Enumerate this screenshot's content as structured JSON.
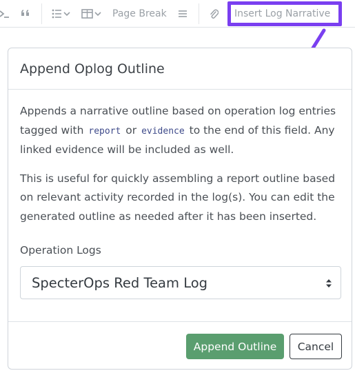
{
  "toolbar": {
    "page_break_label": "Page Break",
    "insert_log_label": "Insert Log Narrative",
    "text_color": "#9aa0a6"
  },
  "annotation": {
    "highlight_color": "#7a3ff0"
  },
  "modal": {
    "title": "Append Oplog Outline",
    "body": {
      "p1_before": "Appends a narrative outline based on operation log entries tagged with ",
      "tag_report": "report",
      "p1_or": " or ",
      "tag_evidence": "evidence",
      "p1_after": " to the end of this field. Any linked evidence will be included as well.",
      "p2": "This is useful for quickly assembling a report outline based on relevant activity recorded in the log(s). You can edit the generated outline as needed after it has been inserted."
    },
    "field_label": "Operation Logs",
    "select_value": "SpecterOps Red Team Log",
    "append_button": "Append Outline",
    "cancel_button": "Cancel",
    "primary_color": "#5a9e6f"
  }
}
